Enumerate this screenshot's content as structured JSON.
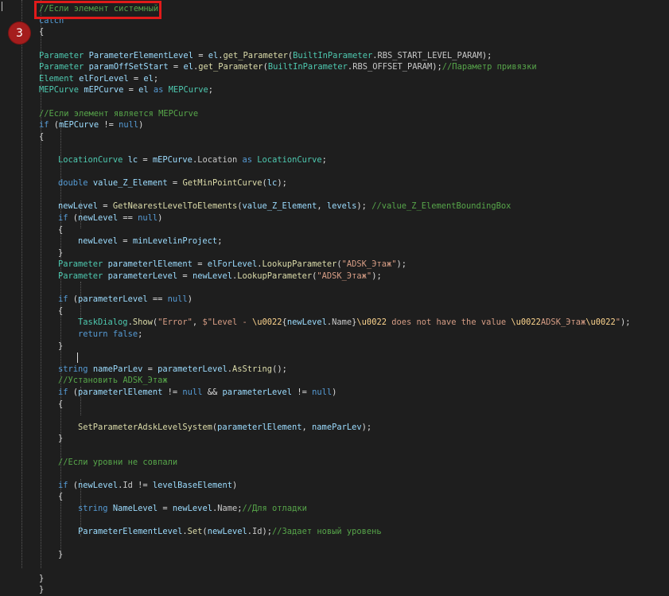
{
  "annotation": {
    "step_number": "3"
  },
  "code_lines": [
    [
      [
        "cm",
        "//Если элемент системный"
      ]
    ],
    [
      [
        "kw",
        "catch"
      ]
    ],
    [
      [
        "pl",
        "{"
      ]
    ],
    [],
    [
      [
        "ty",
        "Parameter"
      ],
      [
        "pl",
        " "
      ],
      [
        "vr",
        "ParameterElementLevel"
      ],
      [
        "pl",
        " = "
      ],
      [
        "vr",
        "el"
      ],
      [
        "pl",
        "."
      ],
      [
        "mt",
        "get_Parameter"
      ],
      [
        "pl",
        "("
      ],
      [
        "ty",
        "BuiltInParameter"
      ],
      [
        "pl",
        "."
      ],
      [
        "pr",
        "RBS_START_LEVEL_PARAM"
      ],
      [
        "pl",
        ");"
      ]
    ],
    [
      [
        "ty",
        "Parameter"
      ],
      [
        "pl",
        " "
      ],
      [
        "vr",
        "paramOffSetStart"
      ],
      [
        "pl",
        " = "
      ],
      [
        "vr",
        "el"
      ],
      [
        "pl",
        "."
      ],
      [
        "mt",
        "get_Parameter"
      ],
      [
        "pl",
        "("
      ],
      [
        "ty",
        "BuiltInParameter"
      ],
      [
        "pl",
        "."
      ],
      [
        "pr",
        "RBS_OFFSET_PARAM"
      ],
      [
        "pl",
        ");"
      ],
      [
        "cm",
        "//Параметр привязки"
      ]
    ],
    [
      [
        "ty",
        "Element"
      ],
      [
        "pl",
        " "
      ],
      [
        "vr",
        "elForLevel"
      ],
      [
        "pl",
        " = "
      ],
      [
        "vr",
        "el"
      ],
      [
        "pl",
        ";"
      ]
    ],
    [
      [
        "ty",
        "MEPCurve"
      ],
      [
        "pl",
        " "
      ],
      [
        "vr",
        "mEPCurve"
      ],
      [
        "pl",
        " = "
      ],
      [
        "vr",
        "el"
      ],
      [
        "pl",
        " "
      ],
      [
        "kw",
        "as"
      ],
      [
        "pl",
        " "
      ],
      [
        "ty",
        "MEPCurve"
      ],
      [
        "pl",
        ";"
      ]
    ],
    [],
    [
      [
        "cm",
        "//Если элемент является MEPCurve"
      ]
    ],
    [
      [
        "kw",
        "if"
      ],
      [
        "pl",
        " ("
      ],
      [
        "vr",
        "mEPCurve"
      ],
      [
        "pl",
        " != "
      ],
      [
        "kw",
        "null"
      ],
      [
        "pl",
        ")"
      ]
    ],
    [
      [
        "pl",
        "{"
      ]
    ],
    [],
    [
      [
        "ty",
        "LocationCurve"
      ],
      [
        "pl",
        " "
      ],
      [
        "vr",
        "lc"
      ],
      [
        "pl",
        " = "
      ],
      [
        "vr",
        "mEPCurve"
      ],
      [
        "pl",
        "."
      ],
      [
        "pr",
        "Location"
      ],
      [
        "pl",
        " "
      ],
      [
        "kw",
        "as"
      ],
      [
        "pl",
        " "
      ],
      [
        "ty",
        "LocationCurve"
      ],
      [
        "pl",
        ";"
      ]
    ],
    [],
    [
      [
        "kw",
        "double"
      ],
      [
        "pl",
        " "
      ],
      [
        "vr",
        "value_Z_Element"
      ],
      [
        "pl",
        " = "
      ],
      [
        "mt",
        "GetMinPointCurve"
      ],
      [
        "pl",
        "("
      ],
      [
        "vr",
        "lc"
      ],
      [
        "pl",
        ");"
      ]
    ],
    [],
    [
      [
        "vr",
        "newLevel"
      ],
      [
        "pl",
        " = "
      ],
      [
        "mt",
        "GetNearestLevelToElements"
      ],
      [
        "pl",
        "("
      ],
      [
        "vr",
        "value_Z_Element"
      ],
      [
        "pl",
        ", "
      ],
      [
        "vr",
        "levels"
      ],
      [
        "pl",
        "); "
      ],
      [
        "cm",
        "//value_Z_ElementBoundingBox"
      ]
    ],
    [
      [
        "kw",
        "if"
      ],
      [
        "pl",
        " ("
      ],
      [
        "vr",
        "newLevel"
      ],
      [
        "pl",
        " == "
      ],
      [
        "kw",
        "null"
      ],
      [
        "pl",
        ")"
      ]
    ],
    [
      [
        "pl",
        "{"
      ]
    ],
    [
      [
        "vr",
        "newLevel"
      ],
      [
        "pl",
        " = "
      ],
      [
        "vr",
        "minLevelinProject"
      ],
      [
        "pl",
        ";"
      ]
    ],
    [
      [
        "pl",
        "}"
      ]
    ],
    [
      [
        "ty",
        "Parameter"
      ],
      [
        "pl",
        " "
      ],
      [
        "vr",
        "parameterlElement"
      ],
      [
        "pl",
        " = "
      ],
      [
        "vr",
        "elForLevel"
      ],
      [
        "pl",
        "."
      ],
      [
        "mt",
        "LookupParameter"
      ],
      [
        "pl",
        "("
      ],
      [
        "st",
        "\"ADSK_Этаж\""
      ],
      [
        "pl",
        ");"
      ]
    ],
    [
      [
        "ty",
        "Parameter"
      ],
      [
        "pl",
        " "
      ],
      [
        "vr",
        "parameterLevel"
      ],
      [
        "pl",
        " = "
      ],
      [
        "vr",
        "newLevel"
      ],
      [
        "pl",
        "."
      ],
      [
        "mt",
        "LookupParameter"
      ],
      [
        "pl",
        "("
      ],
      [
        "st",
        "\"ADSK_Этаж\""
      ],
      [
        "pl",
        ");"
      ]
    ],
    [],
    [
      [
        "kw",
        "if"
      ],
      [
        "pl",
        " ("
      ],
      [
        "vr",
        "parameterLevel"
      ],
      [
        "pl",
        " == "
      ],
      [
        "kw",
        "null"
      ],
      [
        "pl",
        ")"
      ]
    ],
    [
      [
        "pl",
        "{"
      ]
    ],
    [
      [
        "ty",
        "TaskDialog"
      ],
      [
        "pl",
        "."
      ],
      [
        "mt",
        "Show"
      ],
      [
        "pl",
        "("
      ],
      [
        "st",
        "\"Error\""
      ],
      [
        "pl",
        ", "
      ],
      [
        "st",
        "$\"Level - "
      ],
      [
        "es",
        "\\u0022"
      ],
      [
        "pl",
        "{"
      ],
      [
        "vr",
        "newLevel"
      ],
      [
        "pl",
        "."
      ],
      [
        "pr",
        "Name"
      ],
      [
        "pl",
        "}"
      ],
      [
        "es",
        "\\u0022"
      ],
      [
        "st",
        " does not have the value "
      ],
      [
        "es",
        "\\u0022"
      ],
      [
        "st",
        "ADSK_Этаж"
      ],
      [
        "es",
        "\\u0022"
      ],
      [
        "st",
        "\""
      ],
      [
        "pl",
        ");"
      ]
    ],
    [
      [
        "kw",
        "return"
      ],
      [
        "pl",
        " "
      ],
      [
        "kw",
        "false"
      ],
      [
        "pl",
        ";"
      ]
    ],
    [
      [
        "pl",
        "}"
      ]
    ],
    [],
    [
      [
        "kw",
        "string"
      ],
      [
        "pl",
        " "
      ],
      [
        "vr",
        "nameParLev"
      ],
      [
        "pl",
        " = "
      ],
      [
        "vr",
        "parameterLevel"
      ],
      [
        "pl",
        "."
      ],
      [
        "mt",
        "AsString"
      ],
      [
        "pl",
        "();"
      ]
    ],
    [
      [
        "cm",
        "//Установить ADSK_Этаж"
      ]
    ],
    [
      [
        "kw",
        "if"
      ],
      [
        "pl",
        " ("
      ],
      [
        "vr",
        "parameterlElement"
      ],
      [
        "pl",
        " != "
      ],
      [
        "kw",
        "null"
      ],
      [
        "pl",
        " && "
      ],
      [
        "vr",
        "parameterLevel"
      ],
      [
        "pl",
        " != "
      ],
      [
        "kw",
        "null"
      ],
      [
        "pl",
        ")"
      ]
    ],
    [
      [
        "pl",
        "{"
      ]
    ],
    [],
    [
      [
        "mt",
        "SetParameterAdskLevelSystem"
      ],
      [
        "pl",
        "("
      ],
      [
        "vr",
        "parameterlElement"
      ],
      [
        "pl",
        ", "
      ],
      [
        "vr",
        "nameParLev"
      ],
      [
        "pl",
        ");"
      ]
    ],
    [
      [
        "pl",
        "}"
      ]
    ],
    [],
    [
      [
        "cm",
        "//Если уровни не совпали"
      ]
    ],
    [],
    [
      [
        "kw",
        "if"
      ],
      [
        "pl",
        " ("
      ],
      [
        "vr",
        "newLevel"
      ],
      [
        "pl",
        "."
      ],
      [
        "pr",
        "Id"
      ],
      [
        "pl",
        " != "
      ],
      [
        "vr",
        "levelBaseElement"
      ],
      [
        "pl",
        ")"
      ]
    ],
    [
      [
        "pl",
        "{"
      ]
    ],
    [
      [
        "kw",
        "string"
      ],
      [
        "pl",
        " "
      ],
      [
        "vr",
        "NameLevel"
      ],
      [
        "pl",
        " = "
      ],
      [
        "vr",
        "newLevel"
      ],
      [
        "pl",
        "."
      ],
      [
        "pr",
        "Name"
      ],
      [
        "pl",
        ";"
      ],
      [
        "cm",
        "//Для отладки"
      ]
    ],
    [],
    [
      [
        "vr",
        "ParameterElementLevel"
      ],
      [
        "pl",
        "."
      ],
      [
        "mt",
        "Set"
      ],
      [
        "pl",
        "("
      ],
      [
        "vr",
        "newLevel"
      ],
      [
        "pl",
        "."
      ],
      [
        "pr",
        "Id"
      ],
      [
        "pl",
        ");"
      ],
      [
        "cm",
        "//Задает новый уровень"
      ]
    ],
    [],
    [
      [
        "pl",
        "}"
      ]
    ],
    [],
    [
      [
        "pl",
        "}"
      ]
    ],
    [
      [
        "pl",
        "}"
      ]
    ]
  ]
}
